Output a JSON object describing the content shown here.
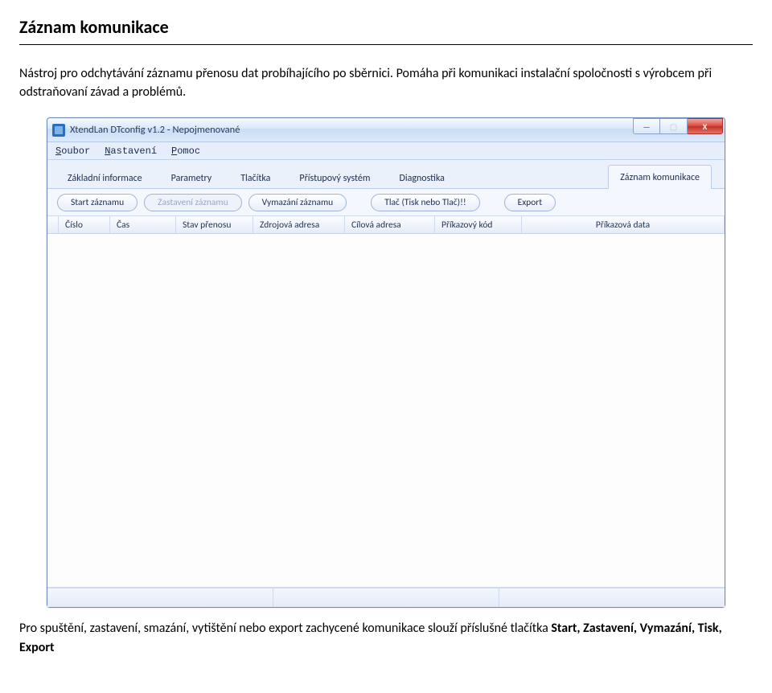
{
  "doc": {
    "title": "Záznam komunikace",
    "intro": "Nástroj pro odchytávání záznamu přenosu dat probíhajícího po sběrnici. Pomáha při komunikaci instalační spoločnosti s výrobcem při odstraňovaní závad a problémů.",
    "outro_before": "Pro spuštění, zastavení, smazání, vytištění nebo export zachycené komunikace slouží příslušné tlačítka ",
    "outro_bold": "Start, Zastavení, Vymazání, Tisk, Export"
  },
  "window": {
    "title": "XtendLan DTconfig v1.2 - Nepojmenované",
    "controls": {
      "min": "—",
      "max": "▢",
      "close": "X"
    }
  },
  "menu": {
    "items": [
      "Soubor",
      "Nastavení",
      "Pomoc"
    ]
  },
  "tabs": {
    "items": [
      "Základní informace",
      "Parametry",
      "Tlačítka",
      "Přístupový systém",
      "Diagnostika",
      "Záznam komunikace"
    ],
    "active_index": 5
  },
  "toolbar": {
    "start": "Start záznamu",
    "stop": "Zastavení záznamu",
    "clear": "Vymazání záznamu",
    "print": "Tlač (Tisk nebo Tlač)!!",
    "export": "Export"
  },
  "table": {
    "headers": {
      "cislo": "Číslo",
      "cas": "Čas",
      "stav": "Stav přenosu",
      "zdroj": "Zdrojová adresa",
      "cil": "Cílová adresa",
      "kod": "Příkazový kód",
      "data": "Příkazová data"
    }
  }
}
